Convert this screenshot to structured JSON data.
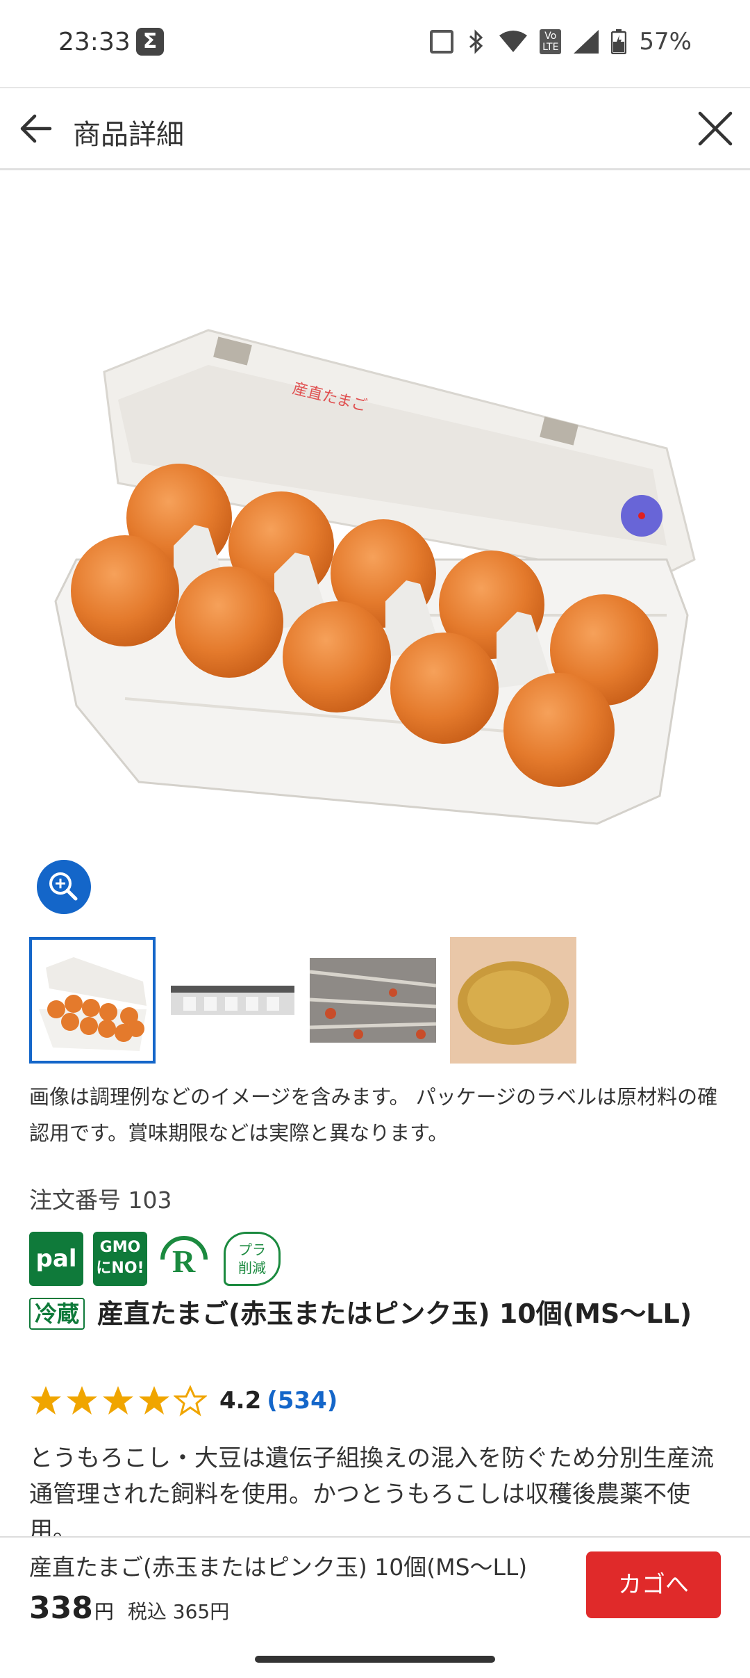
{
  "status": {
    "time": "23:33",
    "battery": "57%"
  },
  "header": {
    "title": "商品詳細"
  },
  "gallery": {
    "images": [
      "egg-pack",
      "egg-pack-side",
      "henhouse",
      "feed"
    ]
  },
  "caption": "画像は調理例などのイメージを含みます。 パッケージのラベルは原材料の確認用です。賞味期限などは実際と異なります。",
  "product": {
    "order_number": "注文番号 103",
    "badges": {
      "pal": "pal",
      "gmo_line1": "GMO",
      "gmo_line2": "にNO!",
      "pla_line1": "プラ",
      "pla_line2": "削減"
    },
    "storage_tag": "冷蔵",
    "name": "産直たまご(赤玉またはピンク玉) 10個(MS～LL)",
    "rating": "4.2",
    "rating_count": "(534)",
    "stars": 4,
    "description": "とうもろこし・大豆は遺伝子組換えの混入を防ぐため分別生産流通管理された飼料を使用。かつとうもろこしは収穫後農薬不使用。"
  },
  "bottom": {
    "name": "産直たまご(赤玉またはピンク玉) 10個(MS～LL)",
    "price": "338",
    "yen": "円",
    "tax_included": "税込 365円",
    "cart_label": "カゴへ"
  }
}
